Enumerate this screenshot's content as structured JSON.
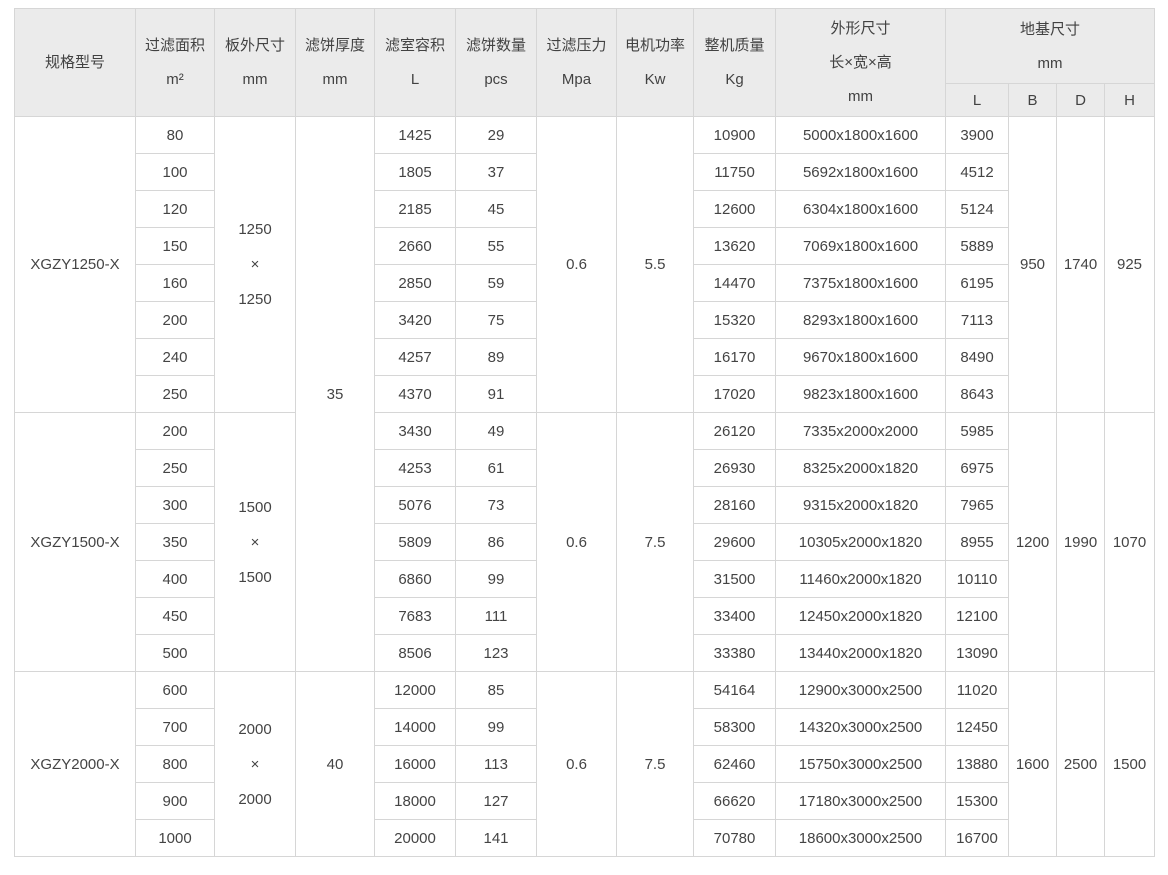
{
  "colors": {
    "header_background": "#ebebeb",
    "border": "#d6d6d6",
    "outer_border": "#c3c3c3",
    "text": "#444444"
  },
  "table": {
    "headers": {
      "model": "规格型号",
      "filter_area": {
        "title": "过滤面积",
        "unit": "m²"
      },
      "plate_size": {
        "title": "板外尺寸",
        "unit": "mm"
      },
      "cake_thickness": {
        "title": "滤饼厚度",
        "unit": "mm"
      },
      "chamber_volume": {
        "title": "滤室容积",
        "unit": "L"
      },
      "cake_count": {
        "title": "滤饼数量",
        "unit": "pcs"
      },
      "filter_pressure": {
        "title": "过滤压力",
        "unit": "Mpa"
      },
      "motor_power": {
        "title": "电机功率",
        "unit": "Kw"
      },
      "machine_weight": {
        "title": "整机质量",
        "unit": "Kg"
      },
      "overall_size": {
        "title": "外形尺寸",
        "subtitle": "长×宽×高",
        "unit": "mm"
      },
      "foundation_size": {
        "title": "地基尺寸",
        "unit": "mm",
        "sub_columns": [
          "L",
          "B",
          "D",
          "H"
        ]
      }
    },
    "groups": [
      {
        "model": "XGZY1250-X",
        "plate_size_lines": [
          "1250",
          "×",
          "1250"
        ],
        "cake_thickness": {
          "value": "35",
          "rowspan": 15
        },
        "filter_pressure": "0.6",
        "motor_power": "5.5",
        "foundation": {
          "B": "950",
          "D": "1740",
          "H": "925"
        },
        "rows": [
          {
            "filter_area": "80",
            "chamber_volume": "1425",
            "cake_count": "29",
            "machine_weight": "10900",
            "overall_size": "5000x1800x1600",
            "foundation_L": "3900"
          },
          {
            "filter_area": "100",
            "chamber_volume": "1805",
            "cake_count": "37",
            "machine_weight": "11750",
            "overall_size": "5692x1800x1600",
            "foundation_L": "4512"
          },
          {
            "filter_area": "120",
            "chamber_volume": "2185",
            "cake_count": "45",
            "machine_weight": "12600",
            "overall_size": "6304x1800x1600",
            "foundation_L": "5124"
          },
          {
            "filter_area": "150",
            "chamber_volume": "2660",
            "cake_count": "55",
            "machine_weight": "13620",
            "overall_size": "7069x1800x1600",
            "foundation_L": "5889"
          },
          {
            "filter_area": "160",
            "chamber_volume": "2850",
            "cake_count": "59",
            "machine_weight": "14470",
            "overall_size": "7375x1800x1600",
            "foundation_L": "6195"
          },
          {
            "filter_area": "200",
            "chamber_volume": "3420",
            "cake_count": "75",
            "machine_weight": "15320",
            "overall_size": "8293x1800x1600",
            "foundation_L": "7113"
          },
          {
            "filter_area": "240",
            "chamber_volume": "4257",
            "cake_count": "89",
            "machine_weight": "16170",
            "overall_size": "9670x1800x1600",
            "foundation_L": "8490"
          },
          {
            "filter_area": "250",
            "chamber_volume": "4370",
            "cake_count": "91",
            "machine_weight": "17020",
            "overall_size": "9823x1800x1600",
            "foundation_L": "8643"
          }
        ]
      },
      {
        "model": "XGZY1500-X",
        "plate_size_lines": [
          "1500",
          "×",
          "1500"
        ],
        "cake_thickness": null,
        "filter_pressure": "0.6",
        "motor_power": "7.5",
        "foundation": {
          "B": "1200",
          "D": "1990",
          "H": "1070"
        },
        "rows": [
          {
            "filter_area": "200",
            "chamber_volume": "3430",
            "cake_count": "49",
            "machine_weight": "26120",
            "overall_size": "7335x2000x2000",
            "foundation_L": "5985"
          },
          {
            "filter_area": "250",
            "chamber_volume": "4253",
            "cake_count": "61",
            "machine_weight": "26930",
            "overall_size": "8325x2000x1820",
            "foundation_L": "6975"
          },
          {
            "filter_area": "300",
            "chamber_volume": "5076",
            "cake_count": "73",
            "machine_weight": "28160",
            "overall_size": "9315x2000x1820",
            "foundation_L": "7965"
          },
          {
            "filter_area": "350",
            "chamber_volume": "5809",
            "cake_count": "86",
            "machine_weight": "29600",
            "overall_size": "10305x2000x1820",
            "foundation_L": "8955"
          },
          {
            "filter_area": "400",
            "chamber_volume": "6860",
            "cake_count": "99",
            "machine_weight": "31500",
            "overall_size": "11460x2000x1820",
            "foundation_L": "10110"
          },
          {
            "filter_area": "450",
            "chamber_volume": "7683",
            "cake_count": "111",
            "machine_weight": "33400",
            "overall_size": "12450x2000x1820",
            "foundation_L": "12100"
          },
          {
            "filter_area": "500",
            "chamber_volume": "8506",
            "cake_count": "123",
            "machine_weight": "33380",
            "overall_size": "13440x2000x1820",
            "foundation_L": "13090"
          }
        ]
      },
      {
        "model": "XGZY2000-X",
        "plate_size_lines": [
          "2000",
          "×",
          "2000"
        ],
        "cake_thickness": {
          "value": "40",
          "rowspan": 5
        },
        "filter_pressure": "0.6",
        "motor_power": "7.5",
        "foundation": {
          "B": "1600",
          "D": "2500",
          "H": "1500"
        },
        "rows": [
          {
            "filter_area": "600",
            "chamber_volume": "12000",
            "cake_count": "85",
            "machine_weight": "54164",
            "overall_size": "12900x3000x2500",
            "foundation_L": "11020"
          },
          {
            "filter_area": "700",
            "chamber_volume": "14000",
            "cake_count": "99",
            "machine_weight": "58300",
            "overall_size": "14320x3000x2500",
            "foundation_L": "12450"
          },
          {
            "filter_area": "800",
            "chamber_volume": "16000",
            "cake_count": "113",
            "machine_weight": "62460",
            "overall_size": "15750x3000x2500",
            "foundation_L": "13880"
          },
          {
            "filter_area": "900",
            "chamber_volume": "18000",
            "cake_count": "127",
            "machine_weight": "66620",
            "overall_size": "17180x3000x2500",
            "foundation_L": "15300"
          },
          {
            "filter_area": "1000",
            "chamber_volume": "20000",
            "cake_count": "141",
            "machine_weight": "70780",
            "overall_size": "18600x3000x2500",
            "foundation_L": "16700"
          }
        ]
      }
    ]
  }
}
